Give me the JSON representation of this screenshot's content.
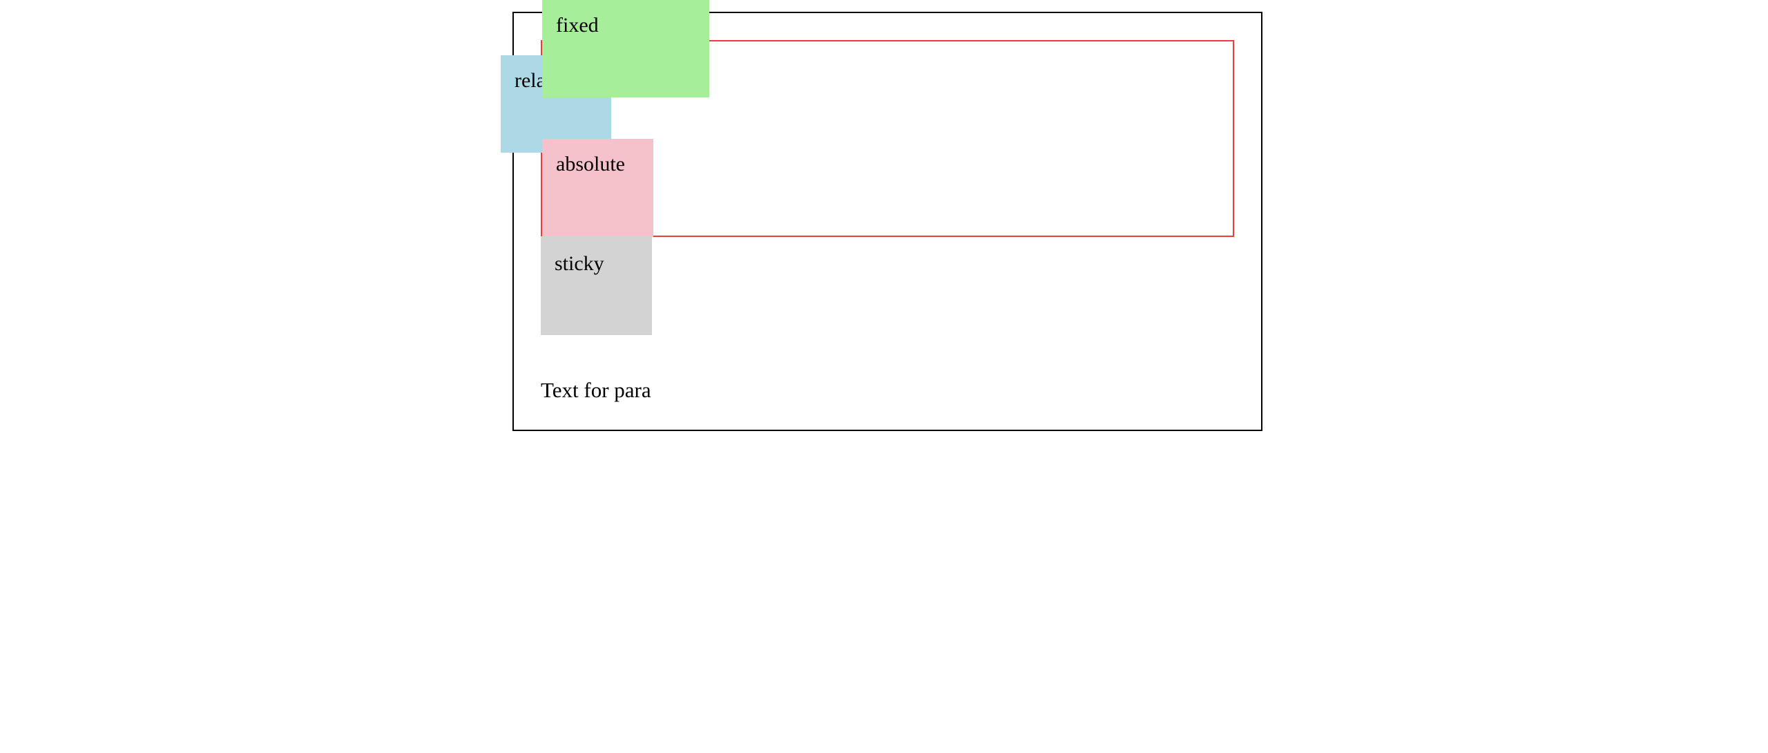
{
  "boxes": {
    "relative_label": "relative",
    "fixed_label": "fixed",
    "absolute_label": "absolute",
    "sticky_label": "sticky"
  },
  "paragraph": {
    "text": "Text for para"
  },
  "colors": {
    "relative": "#add8e6",
    "fixed": "#a6ee9a",
    "absolute": "#f5c2cb",
    "sticky": "#d3d3d3",
    "outline": "#ef3b3b",
    "border": "#000000"
  }
}
